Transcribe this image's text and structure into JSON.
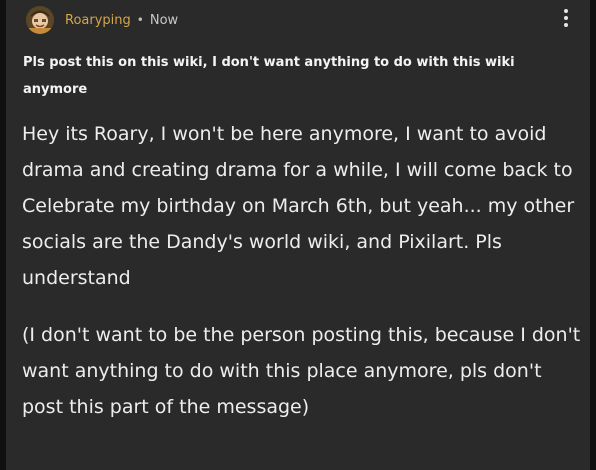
{
  "post": {
    "author": {
      "username": "Roaryping",
      "avatar_icon": "avatar-image"
    },
    "separator": "•",
    "timestamp": "Now",
    "menu_icon": "more-vertical-icon",
    "title": "Pls post this on this wiki, I don't want anything to do with this wiki anymore",
    "paragraphs": [
      "Hey its Roary, I won't be here anymore, I want to avoid drama and creating drama for a while, I will come back to Celebrate my birthday on March 6th, but yeah... my other socials are the Dandy's world wiki, and Pixilart. Pls understand",
      "(I don't want to be the person posting this, because I don't want anything to do with this place anymore, pls don't post this part of the message)"
    ]
  },
  "colors": {
    "card_background": "#2a2a2a",
    "username": "#d4a64a",
    "text": "#ededed"
  }
}
